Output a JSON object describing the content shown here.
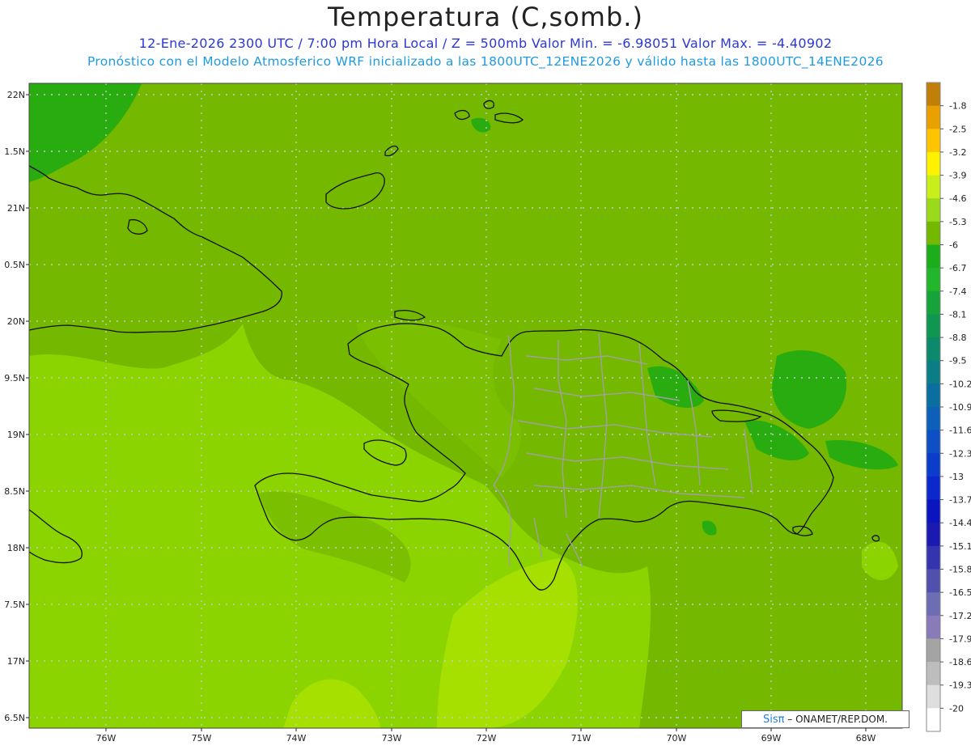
{
  "header": {
    "title": "Temperatura (C,somb.)",
    "info_line": "12-Ene-2026  2300 UTC / 7:00 pm Hora Local / Z = 500mb  Valor Min. = -6.98051  Valor Max. = -4.40902",
    "model_line": "Pronóstico con el Modelo Atmosferico WRF inicializado a las 1800UTC_12ENE2026 y válido hasta las  1800UTC_14ENE2026"
  },
  "map": {
    "lat_labels": [
      "22N",
      "1.5N",
      "21N",
      "0.5N",
      "20N",
      "9.5N",
      "19N",
      "8.5N",
      "18N",
      "7.5N",
      "17N",
      "6.5N"
    ],
    "lon_labels": [
      "76W",
      "75W",
      "74W",
      "73W",
      "72W",
      "71W",
      "70W",
      "69W",
      "68W"
    ]
  },
  "colorbar": {
    "labels": [
      "-1.8",
      "-2.5",
      "-3.2",
      "-3.9",
      "-4.6",
      "-5.3",
      "-6",
      "-6.7",
      "-7.4",
      "-8.1",
      "-8.8",
      "-9.5",
      "-10.2",
      "-10.9",
      "-11.6",
      "-12.3",
      "-13",
      "-13.7",
      "-14.4",
      "-15.1",
      "-15.8",
      "-16.5",
      "-17.2",
      "-17.9",
      "-18.6",
      "-19.3",
      "-20"
    ],
    "colors": [
      "#c17f0a",
      "#e8a100",
      "#ffc400",
      "#fff200",
      "#c9ef1a",
      "#9bd91b",
      "#74b800",
      "#1cad1c",
      "#22b62c",
      "#16a43a",
      "#0f9650",
      "#0d8a6b",
      "#0b7d85",
      "#0a6e9e",
      "#0d5fb8",
      "#0d4fc4",
      "#0b3ccc",
      "#0a28cc",
      "#0a14bf",
      "#1a1ab0",
      "#3434ae",
      "#5050ad",
      "#6d6db3",
      "#8a7ab8",
      "#a4a4a4",
      "#bdbdbd",
      "#dedede",
      "#ffffff"
    ]
  },
  "credit": {
    "brand": "Sisπ",
    "text": " – ONAMET/REP.DOM."
  }
}
